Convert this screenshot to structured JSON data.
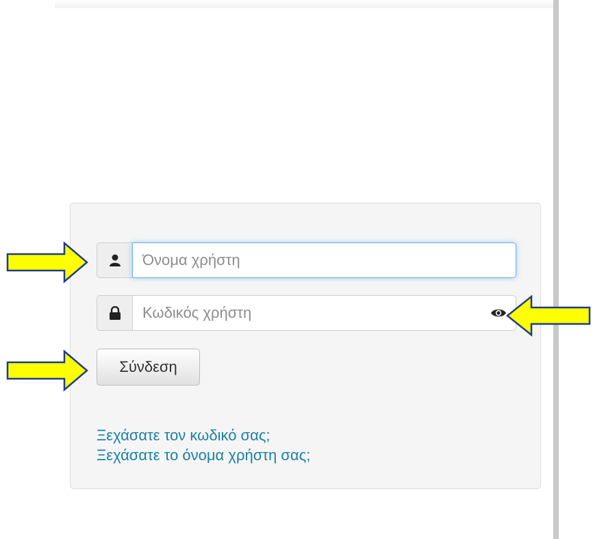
{
  "login": {
    "username_placeholder": "Όνομα χρήστη",
    "password_placeholder": "Κωδικός χρήστη",
    "submit_label": "Σύνδεση",
    "forgot_password_link": "Ξεχάσατε τον κωδικό σας;",
    "forgot_username_link": "Ξεχάσατε το όνομα χρήστη σας;"
  },
  "icons": {
    "username_addon": "user-icon",
    "password_addon": "lock-icon",
    "password_toggle": "eye-icon",
    "annotation": "arrow-icon"
  },
  "colors": {
    "link": "#1a80a6",
    "focus_border": "#66afe9",
    "annotation_arrow_fill": "#ffff00",
    "annotation_arrow_stroke": "#1f3b8f"
  }
}
